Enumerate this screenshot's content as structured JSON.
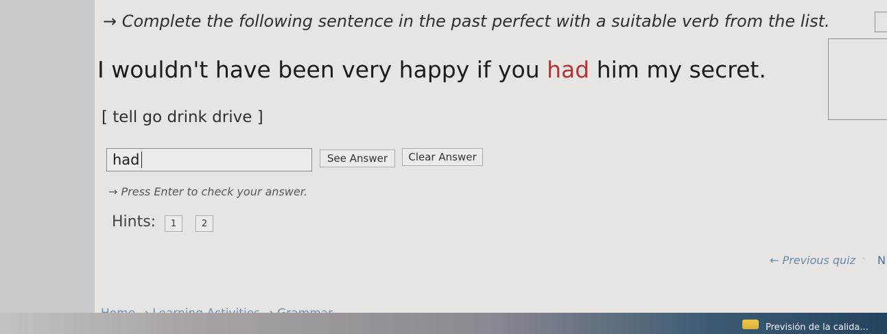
{
  "instruction": "→ Complete the following sentence in the past perfect with a suitable verb from the list.",
  "sentence": {
    "part1": "I wouldn't have been very happy if you ",
    "highlight": "had",
    "part2": " him my secret."
  },
  "verb_list": "[ tell go drink drive ]",
  "answer_input": {
    "value": "had"
  },
  "buttons": {
    "see_answer": "See Answer",
    "clear_answer": "Clear Answer"
  },
  "press_enter": "→ Press Enter to check your answer.",
  "hints": {
    "label": "Hints:",
    "items": [
      "1",
      "2"
    ]
  },
  "navigation": {
    "previous": "← Previous quiz",
    "separator": "·",
    "next": "N"
  },
  "breadcrumb": "Home → Learning Activities → Grammar",
  "taskbar": {
    "text": "Previsión de la calida..."
  }
}
